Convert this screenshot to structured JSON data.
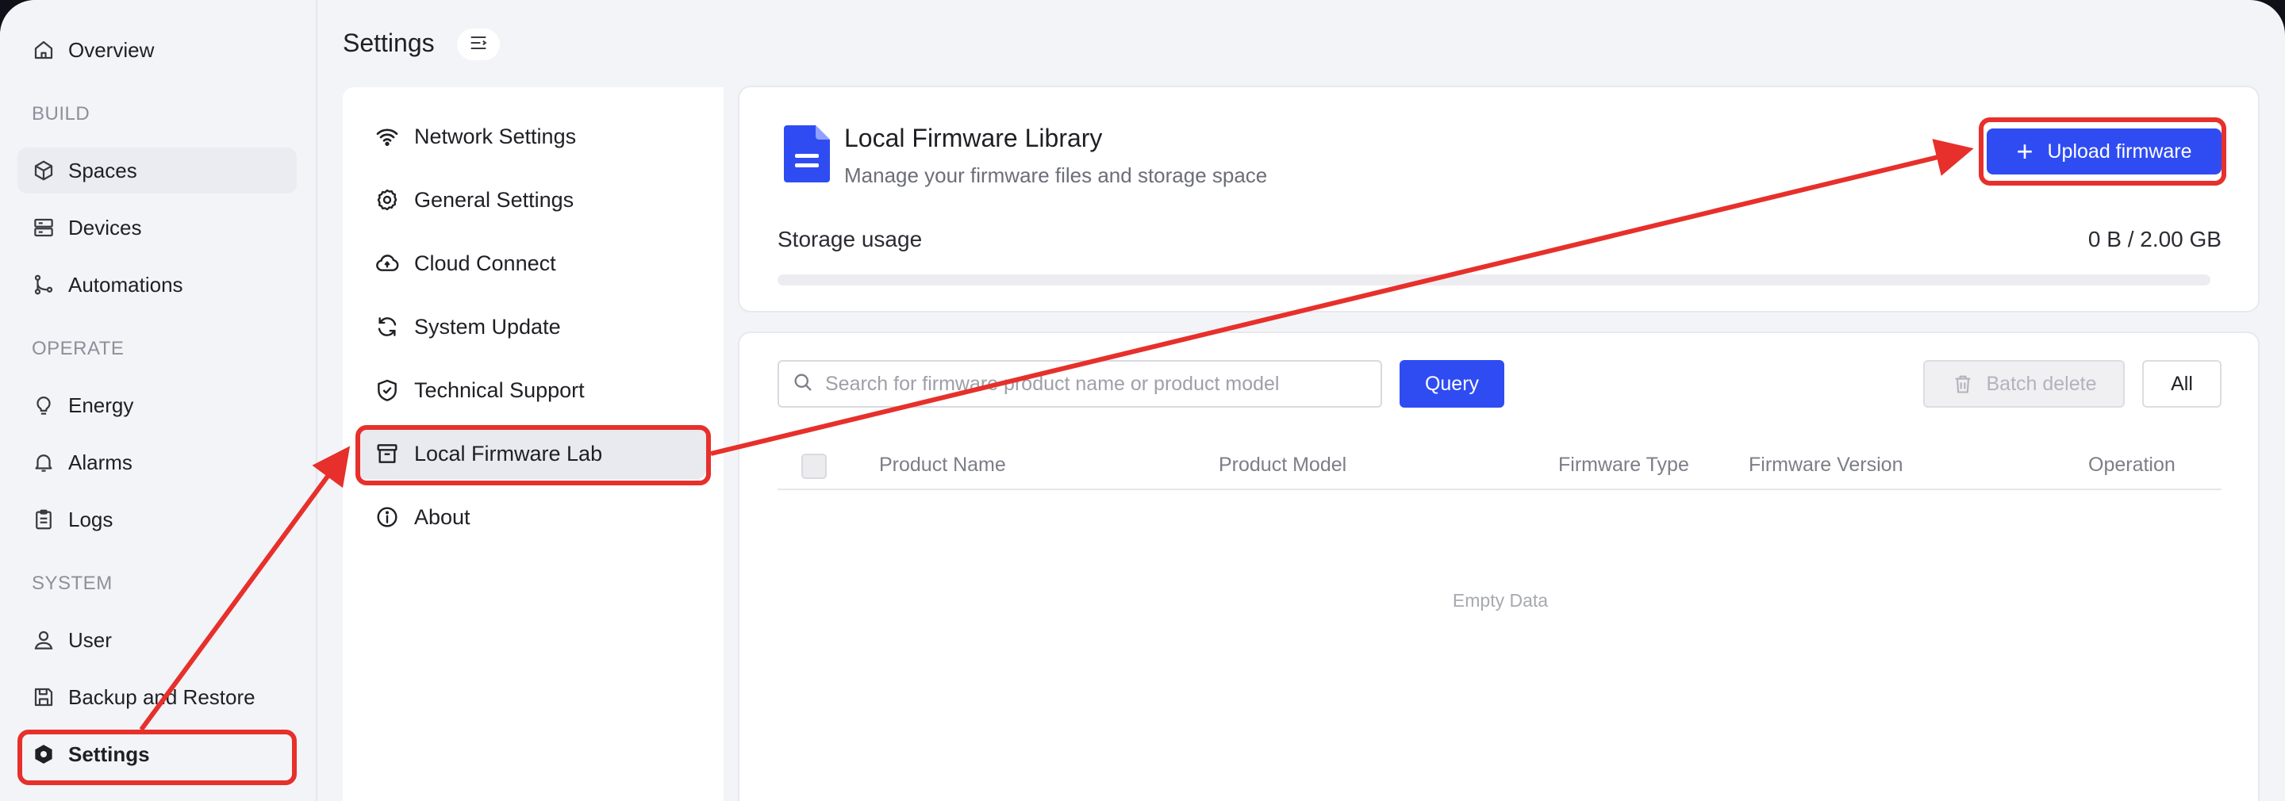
{
  "sidebar": {
    "items": [
      {
        "label": "Overview",
        "icon": "home-icon"
      },
      {
        "label": "Spaces",
        "icon": "cube-icon"
      },
      {
        "label": "Devices",
        "icon": "server-icon"
      },
      {
        "label": "Automations",
        "icon": "flow-icon"
      },
      {
        "label": "Energy",
        "icon": "bulb-icon"
      },
      {
        "label": "Alarms",
        "icon": "bell-icon"
      },
      {
        "label": "Logs",
        "icon": "clipboard-icon"
      },
      {
        "label": "User",
        "icon": "user-icon"
      },
      {
        "label": "Backup and Restore",
        "icon": "save-icon"
      },
      {
        "label": "Settings",
        "icon": "hexagon-gear-icon"
      }
    ],
    "sections": [
      "BUILD",
      "OPERATE",
      "SYSTEM"
    ]
  },
  "header": {
    "title": "Settings",
    "collapse_icon": "menu-collapse-icon"
  },
  "settings_menu": {
    "items": [
      {
        "label": "Network Settings",
        "icon": "wifi-icon"
      },
      {
        "label": "General Settings",
        "icon": "gear-icon"
      },
      {
        "label": "Cloud Connect",
        "icon": "cloud-icon"
      },
      {
        "label": "System Update",
        "icon": "refresh-icon"
      },
      {
        "label": "Technical Support",
        "icon": "shield-check-icon"
      },
      {
        "label": "Local Firmware Lab",
        "icon": "archive-icon"
      },
      {
        "label": "About",
        "icon": "info-icon"
      }
    ],
    "active": "Local Firmware Lab"
  },
  "library": {
    "title": "Local Firmware Library",
    "subtitle": "Manage your firmware files and storage space",
    "upload_label": "Upload firmware",
    "storage_label": "Storage usage",
    "storage_value": "0 B / 2.00 GB",
    "storage_fraction": 0
  },
  "table": {
    "search_placeholder": "Search for firmware product name or product model",
    "query_label": "Query",
    "batch_delete_label": "Batch delete",
    "filter_label": "All",
    "columns": [
      "Product Name",
      "Product Model",
      "Firmware Type",
      "Firmware Version",
      "Operation"
    ],
    "rows": [],
    "empty_text": "Empty Data"
  },
  "colors": {
    "accent": "#2f4cf2",
    "annotation": "#e7302b",
    "background": "#f3f4f8"
  }
}
